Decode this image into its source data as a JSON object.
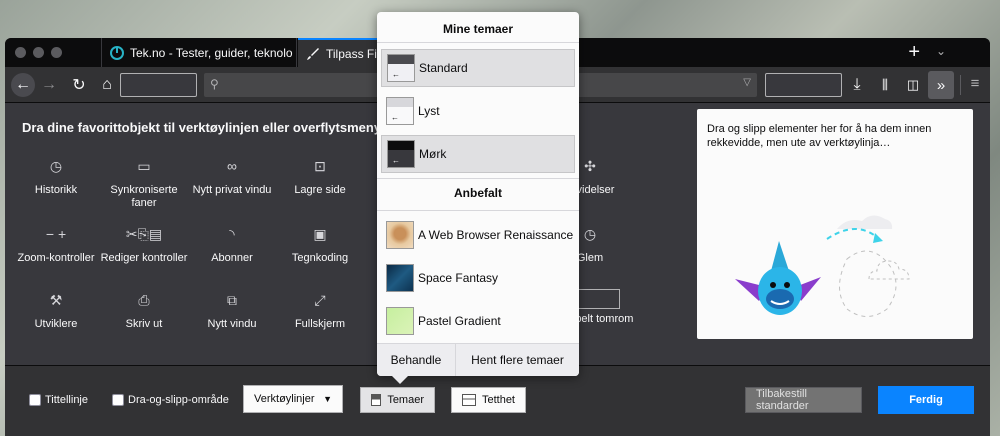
{
  "tabs": [
    {
      "label": "Tek.no - Tester, guider, teknolo",
      "icon": "power-icon"
    },
    {
      "label": "Tilpass Firef",
      "icon": "brush-icon"
    }
  ],
  "customize": {
    "title": "Dra dine favorittobjekt til verktøylinjen eller overflytsmenyen.",
    "items": [
      {
        "label": "Historikk",
        "icon": "clock-icon"
      },
      {
        "label": "Synkroniserte faner",
        "icon": "laptop-icon"
      },
      {
        "label": "Nytt privat vindu",
        "icon": "mask-icon"
      },
      {
        "label": "Lagre side",
        "icon": "save-page-icon"
      },
      {
        "label": "Utvidelser",
        "icon": "puzzle-icon"
      },
      {
        "label": "Zoom-kontroller",
        "icon": "zoom-icon"
      },
      {
        "label": "Rediger kontroller",
        "icon": "edit-icon"
      },
      {
        "label": "Abonner",
        "icon": "rss-icon"
      },
      {
        "label": "Tegnkoding",
        "icon": "encoding-icon"
      },
      {
        "label": "Glem",
        "icon": "forget-icon"
      },
      {
        "label": "Utviklere",
        "icon": "wrench-icon"
      },
      {
        "label": "Skriv ut",
        "icon": "printer-icon"
      },
      {
        "label": "Nytt vindu",
        "icon": "new-window-icon"
      },
      {
        "label": "Fullskjerm",
        "icon": "fullscreen-icon"
      },
      {
        "label": "Fleksibelt tomrom",
        "icon": "flexible-space-icon"
      }
    ]
  },
  "overflow_panel": {
    "text": "Dra og slipp elementer her for å ha dem innen rekkevidde, men ute av verktøylinja…"
  },
  "themes_popup": {
    "my_header": "Mine temaer",
    "my_themes": [
      "Standard",
      "Lyst",
      "Mørk"
    ],
    "recommended_header": "Anbefalt",
    "recommended": [
      "A Web Browser Renaissance",
      "Space Fantasy",
      "Pastel Gradient"
    ],
    "manage": "Behandle",
    "get_more": "Hent flere temaer"
  },
  "footer": {
    "title_bar": "Tittellinje",
    "drag_space": "Dra-og-slipp-område",
    "toolbars": "Verktøylinjer",
    "themes": "Temaer",
    "density": "Tetthet",
    "restore": "Tilbakestill standarder",
    "done": "Ferdig"
  },
  "colors": {
    "accent": "#0a84ff",
    "chrome": "#38383d",
    "tabbar": "#0c0c0d"
  }
}
